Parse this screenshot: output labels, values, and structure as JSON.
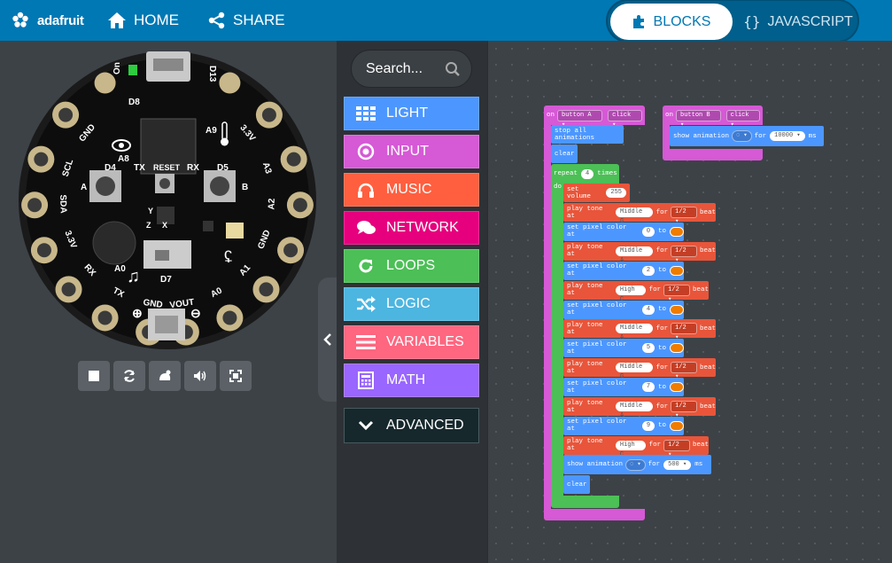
{
  "topbar": {
    "brand": "adafruit",
    "home": "HOME",
    "share": "SHARE",
    "blocks_tab": "BLOCKS",
    "js_tab": "JAVASCRIPT"
  },
  "board": {
    "pads_left": [
      "GND",
      "SCL",
      "SDA",
      "3.3V",
      "RX",
      "TX",
      "GND"
    ],
    "pads_left_sub": [
      "A4",
      "A5",
      "A6",
      "A7"
    ],
    "pads_right": [
      "3.3V",
      "A3",
      "A2",
      "GND",
      "A1",
      "A0",
      "VOUT"
    ],
    "labels": {
      "on": "On",
      "d13": "D13",
      "d8": "D8",
      "a8": "A8",
      "a9": "A9",
      "d4": "D4",
      "d5": "D5",
      "tx": "TX",
      "rx": "RX",
      "reset": "RESET",
      "a": "A",
      "b": "B",
      "d7": "D7",
      "a0": "A0",
      "y": "Y",
      "z": "Z",
      "x": "X"
    }
  },
  "sim_controls": [
    "stop-icon",
    "restart-icon",
    "slow-motion-icon",
    "sound-icon",
    "fullscreen-icon"
  ],
  "toolbox": {
    "search_placeholder": "Search...",
    "categories": [
      {
        "label": "LIGHT",
        "color": "#4c97ff",
        "icon": "grid-icon"
      },
      {
        "label": "INPUT",
        "color": "#d659d6",
        "icon": "target-icon"
      },
      {
        "label": "MUSIC",
        "color": "#ff5f3f",
        "icon": "headphones-icon"
      },
      {
        "label": "NETWORK",
        "color": "#e6007e",
        "icon": "chat-icon"
      },
      {
        "label": "LOOPS",
        "color": "#4cbf56",
        "icon": "refresh-icon"
      },
      {
        "label": "LOGIC",
        "color": "#4cb5e0",
        "icon": "shuffle-icon"
      },
      {
        "label": "VARIABLES",
        "color": "#ff6680",
        "icon": "list-icon"
      },
      {
        "label": "MATH",
        "color": "#9966ff",
        "icon": "calculator-icon"
      }
    ],
    "advanced": "ADVANCED"
  },
  "program": {
    "on_a": {
      "on": "on",
      "button": "button A",
      "event": "click"
    },
    "on_b": {
      "on": "on",
      "button": "button B",
      "event": "click",
      "show": "show animation",
      "for": "for",
      "ms_value": "10000",
      "ms": "ms"
    },
    "stop_all": "stop all animations",
    "clear": "clear",
    "repeat": {
      "label": "repeat",
      "count": "4",
      "times": "times",
      "do": "do"
    },
    "set_volume": {
      "label": "set volume",
      "value": "255"
    },
    "sequence": [
      {
        "kind": "tone",
        "note": "Middle G",
        "beat": "1/2"
      },
      {
        "kind": "pixel",
        "index": "0"
      },
      {
        "kind": "tone",
        "note": "Middle A",
        "beat": "1/2"
      },
      {
        "kind": "pixel",
        "index": "2"
      },
      {
        "kind": "tone",
        "note": "High C",
        "beat": "1/2"
      },
      {
        "kind": "pixel",
        "index": "4"
      },
      {
        "kind": "tone",
        "note": "Middle A",
        "beat": "1/2"
      },
      {
        "kind": "pixel",
        "index": "5"
      },
      {
        "kind": "tone",
        "note": "Middle G",
        "beat": "1/2"
      },
      {
        "kind": "pixel",
        "index": "7"
      },
      {
        "kind": "tone",
        "note": "Middle A",
        "beat": "1/2"
      },
      {
        "kind": "pixel",
        "index": "9"
      },
      {
        "kind": "tone",
        "note": "High C",
        "beat": "1/2"
      }
    ],
    "tone_words": {
      "play": "play tone at",
      "for": "for",
      "beat": "beat"
    },
    "pixel_words": {
      "set": "set pixel color at",
      "to": "to"
    },
    "show_anim": {
      "label": "show animation",
      "for": "for",
      "value": "500",
      "ms": "ms"
    },
    "end_clear": "clear"
  },
  "colors": {
    "topbar": "#0078b4",
    "event": "#d659d6",
    "light": "#4c97ff",
    "loops": "#4cbf56",
    "music": "#e8553a"
  }
}
